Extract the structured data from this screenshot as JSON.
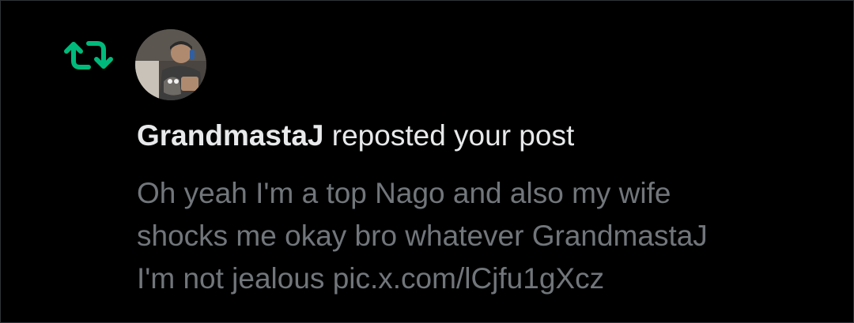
{
  "notification": {
    "type_icon": "repost-icon",
    "accent_color": "#00ba7c",
    "user": {
      "name": "GrandmastaJ",
      "avatar_icon": "avatar"
    },
    "action_text": " reposted your post",
    "post_text_lines": [
      "Oh yeah I'm a top Nago and also my wife",
      "shocks me okay bro whatever GrandmastaJ",
      "I'm not jealous pic.x.com/lCjfu1gXcz"
    ]
  },
  "colors": {
    "background": "#000000",
    "primary_text": "#e7e9ea",
    "secondary_text": "#71767b",
    "repost_green": "#00ba7c"
  }
}
